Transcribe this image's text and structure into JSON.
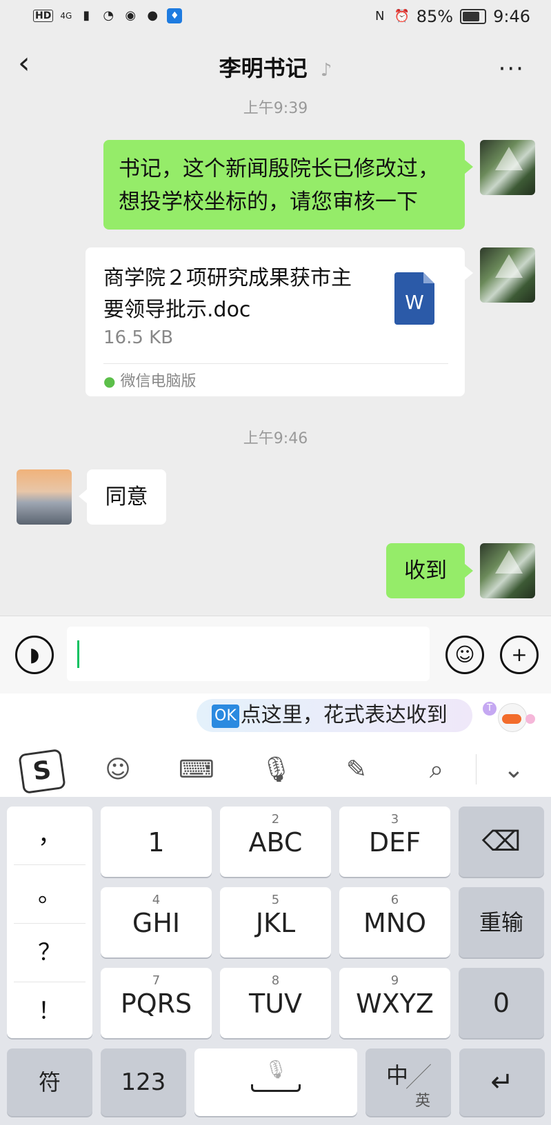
{
  "status_bar": {
    "left_icons": [
      "hd-icon",
      "signal-icon",
      "wifi-icon",
      "eye-icon",
      "chat-icon",
      "bulb-icon"
    ],
    "hd": "HD",
    "network": "4G",
    "battery": "85%",
    "time": "9:46"
  },
  "header": {
    "title": "李明书记",
    "back_icon": "‹",
    "ear_icon": "♪",
    "more_icon": "···"
  },
  "messages": {
    "time1": "上午9:39",
    "msg1_line1": "书记，这个新闻殷院长已修改过，",
    "msg1_line2": "想投学校坐标的，请您审核一下",
    "file_name_line1": "商学院２项研究成果获市主",
    "file_name_line2": "要领导批示.doc",
    "file_size": "16.5 KB",
    "file_icon_letter": "W",
    "file_source": "微信电脑版",
    "time2": "上午9:46",
    "reply": "同意",
    "ack": "收到"
  },
  "input_bar": {
    "voice_icon": "voice-icon",
    "emoji_icon": "emoji-icon",
    "plus_icon": "plus-icon",
    "value": ""
  },
  "suggestion": {
    "badge": "OK",
    "text": "点这里，花式表达收到"
  },
  "keyboard": {
    "punctuation": [
      "，",
      "。",
      "？",
      "！"
    ],
    "row1": [
      {
        "sup": "",
        "main": "1"
      },
      {
        "sup": "2",
        "main": "ABC"
      },
      {
        "sup": "3",
        "main": "DEF"
      }
    ],
    "row2": [
      {
        "sup": "4",
        "main": "GHI"
      },
      {
        "sup": "5",
        "main": "JKL"
      },
      {
        "sup": "6",
        "main": "MNO"
      }
    ],
    "row3": [
      {
        "sup": "7",
        "main": "PQRS"
      },
      {
        "sup": "8",
        "main": "TUV"
      },
      {
        "sup": "9",
        "main": "WXYZ"
      }
    ],
    "delete_icon": "⌫",
    "reset": "重输",
    "zero": "0",
    "symbols": "符",
    "numbers": "123",
    "lang_main": "中",
    "lang_sub": "英",
    "enter_icon": "↵"
  }
}
